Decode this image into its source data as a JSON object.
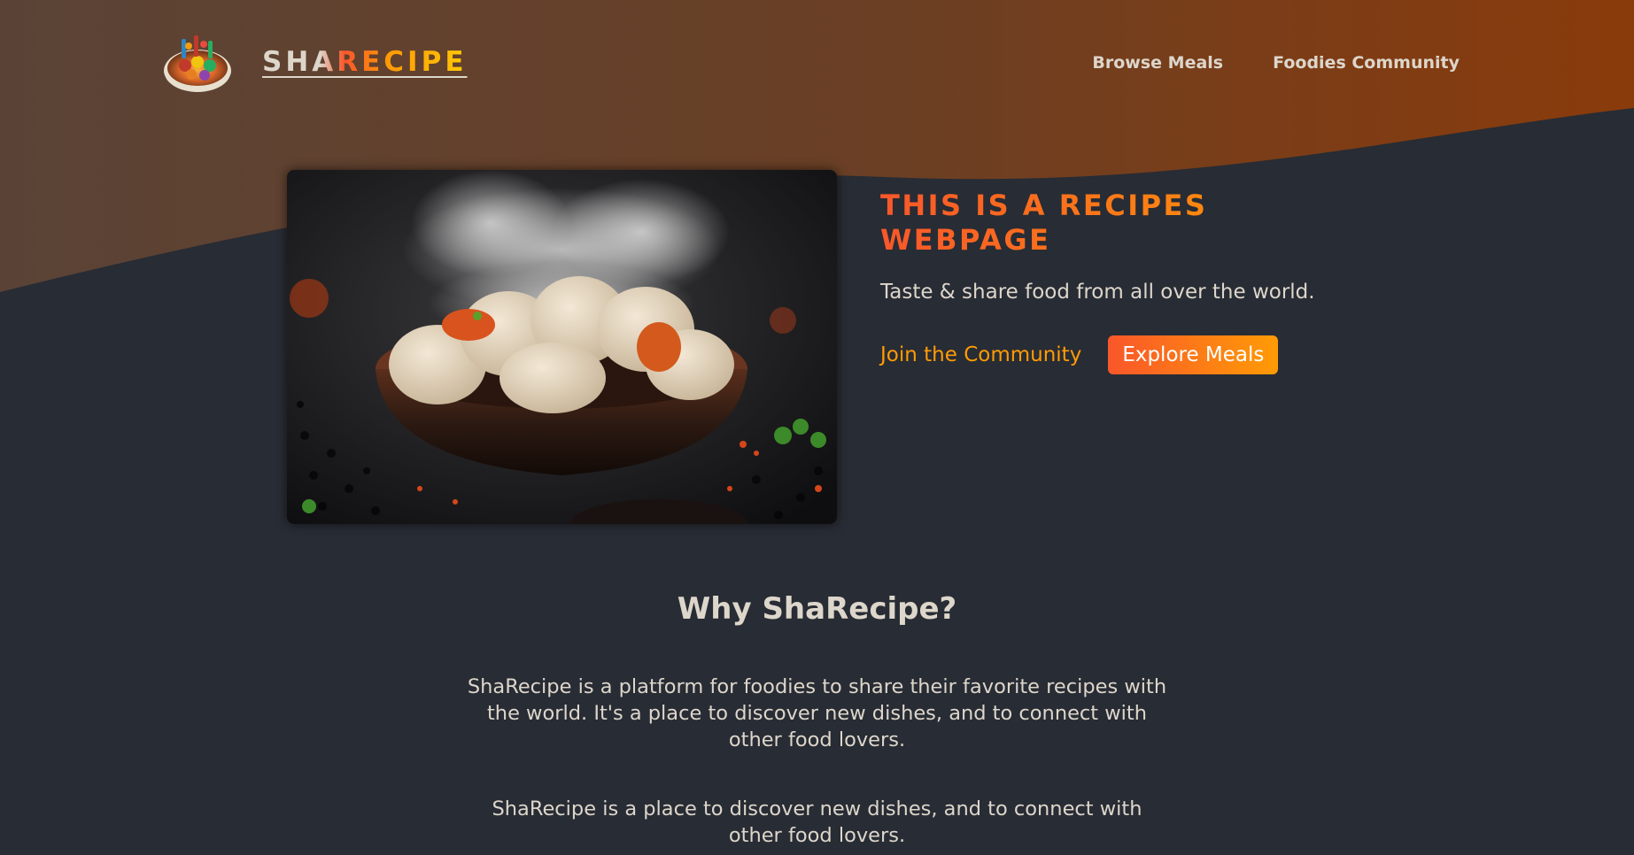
{
  "colors": {
    "page_background": "#282c34",
    "header_gradient_start": "#5a4336",
    "header_gradient_end": "#8a3b0b",
    "accent_orange": "#f9572a",
    "accent_amber": "#ff9b05",
    "text_light": "#ddd6cb"
  },
  "header": {
    "logo_icon": "food-plate-logo",
    "logo_text": "SHARECIPE",
    "nav": {
      "browse": "Browse Meals",
      "community": "Foodies Community"
    }
  },
  "hero": {
    "image_icon": "steaming-dumplings-photo",
    "title": "THIS IS A RECIPES WEBPAGE",
    "subtitle": "Taste & share food from all over the world.",
    "cta": {
      "join": "Join the Community",
      "explore": "Explore Meals"
    }
  },
  "why": {
    "heading": "Why ShaRecipe?",
    "paragraph1": "ShaRecipe is a platform for foodies to share their favorite recipes with the world. It's a place to discover new dishes, and to connect with other food lovers.",
    "paragraph2": "ShaRecipe is a place to discover new dishes, and to connect with other food lovers."
  }
}
